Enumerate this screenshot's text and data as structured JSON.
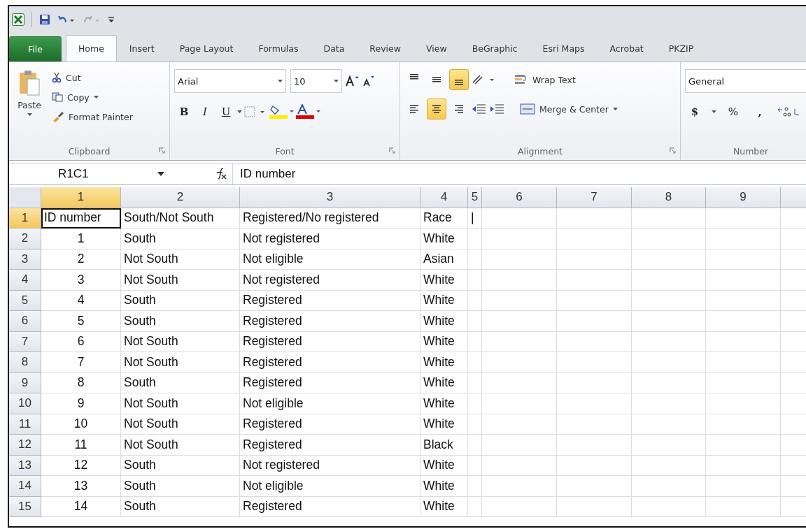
{
  "tabs": [
    {
      "label": "File",
      "kind": "file",
      "selected": false
    },
    {
      "label": "Home",
      "kind": "tab",
      "selected": true
    },
    {
      "label": "Insert",
      "kind": "tab",
      "selected": false
    },
    {
      "label": "Page Layout",
      "kind": "tab",
      "selected": false
    },
    {
      "label": "Formulas",
      "kind": "tab",
      "selected": false
    },
    {
      "label": "Data",
      "kind": "tab",
      "selected": false
    },
    {
      "label": "Review",
      "kind": "tab",
      "selected": false
    },
    {
      "label": "View",
      "kind": "tab",
      "selected": false
    },
    {
      "label": "BeGraphic",
      "kind": "tab",
      "selected": false
    },
    {
      "label": "Esri Maps",
      "kind": "tab",
      "selected": false
    },
    {
      "label": "Acrobat",
      "kind": "tab",
      "selected": false
    },
    {
      "label": "PKZIP",
      "kind": "tab",
      "selected": false
    }
  ],
  "ribbon": {
    "clipboard": {
      "label": "Clipboard",
      "paste": "Paste",
      "cut": "Cut",
      "copy": "Copy",
      "format_painter": "Format Painter"
    },
    "font": {
      "label": "Font",
      "font_name": "Arial",
      "font_size": "10",
      "bold": "B",
      "italic": "I",
      "underline": "U"
    },
    "alignment": {
      "label": "Alignment",
      "vertical": [
        {
          "kind": "top",
          "selected": false
        },
        {
          "kind": "middle",
          "selected": false
        },
        {
          "kind": "bottom",
          "selected": true
        }
      ],
      "horizontal": [
        {
          "kind": "left",
          "selected": false
        },
        {
          "kind": "center",
          "selected": true
        },
        {
          "kind": "right",
          "selected": false
        }
      ],
      "wrap_text": "Wrap Text",
      "merge_center": "Merge & Center"
    },
    "number": {
      "label": "Number",
      "format": "General",
      "currency": "$",
      "percent": "%",
      "comma": ","
    }
  },
  "formula_bar": {
    "name_box": "R1C1",
    "value": "ID number"
  },
  "sheet": {
    "columns": [
      {
        "label": "1",
        "selected": true
      },
      {
        "label": "2",
        "selected": false
      },
      {
        "label": "3",
        "selected": false
      },
      {
        "label": "4",
        "selected": false
      },
      {
        "label": "5",
        "selected": false
      },
      {
        "label": "6",
        "selected": false
      },
      {
        "label": "7",
        "selected": false
      },
      {
        "label": "8",
        "selected": false
      },
      {
        "label": "9",
        "selected": false
      }
    ],
    "rows": [
      {
        "header": "1",
        "selected": true,
        "cells": [
          "ID number",
          "South/Not South",
          "Registered/No registered",
          "Race",
          "|"
        ]
      },
      {
        "header": "2",
        "selected": false,
        "cells": [
          "1",
          "South",
          "Not registered",
          "White"
        ]
      },
      {
        "header": "3",
        "selected": false,
        "cells": [
          "2",
          "Not South",
          "Not eligible",
          "Asian"
        ]
      },
      {
        "header": "4",
        "selected": false,
        "cells": [
          "3",
          "Not South",
          "Not registered",
          "White"
        ]
      },
      {
        "header": "5",
        "selected": false,
        "cells": [
          "4",
          "South",
          "Registered",
          "White"
        ]
      },
      {
        "header": "6",
        "selected": false,
        "cells": [
          "5",
          "South",
          "Registered",
          "White"
        ]
      },
      {
        "header": "7",
        "selected": false,
        "cells": [
          "6",
          "Not South",
          "Registered",
          "White"
        ]
      },
      {
        "header": "8",
        "selected": false,
        "cells": [
          "7",
          "Not South",
          "Registered",
          "White"
        ]
      },
      {
        "header": "9",
        "selected": false,
        "cells": [
          "8",
          "South",
          "Registered",
          "White"
        ]
      },
      {
        "header": "10",
        "selected": false,
        "cells": [
          "9",
          "Not South",
          "Not eligible",
          "White"
        ]
      },
      {
        "header": "11",
        "selected": false,
        "cells": [
          "10",
          "Not South",
          "Registered",
          "White"
        ]
      },
      {
        "header": "12",
        "selected": false,
        "cells": [
          "11",
          "Not South",
          "Registered",
          "Black"
        ]
      },
      {
        "header": "13",
        "selected": false,
        "cells": [
          "12",
          "South",
          "Not registered",
          "White"
        ]
      },
      {
        "header": "14",
        "selected": false,
        "cells": [
          "13",
          "South",
          "Not eligible",
          "White"
        ]
      },
      {
        "header": "15",
        "selected": false,
        "cells": [
          "14",
          "South",
          "Registered",
          "White"
        ]
      }
    ]
  }
}
